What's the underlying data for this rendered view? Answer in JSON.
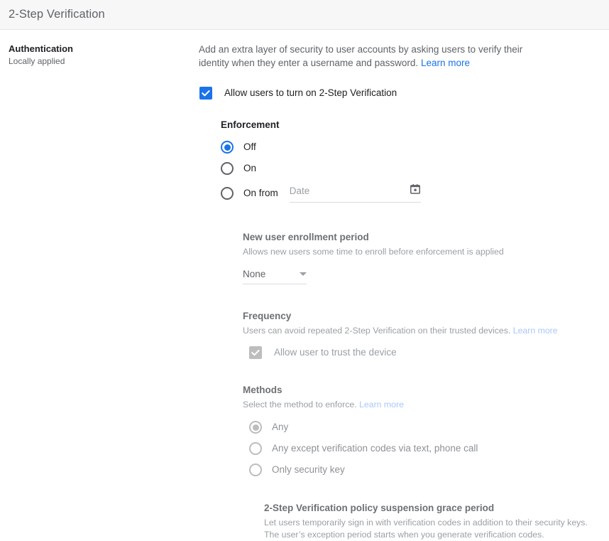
{
  "header": {
    "title": "2-Step Verification"
  },
  "left": {
    "section_name": "Authentication",
    "section_sub": "Locally applied"
  },
  "intro": {
    "text": "Add an extra layer of security to user accounts by asking users to verify their identity when they enter a username and password. ",
    "learn_more": "Learn more"
  },
  "allow": {
    "label": "Allow users to turn on 2-Step Verification",
    "checked": true
  },
  "enforcement": {
    "title": "Enforcement",
    "options": [
      {
        "label": "Off",
        "checked": true
      },
      {
        "label": "On",
        "checked": false
      },
      {
        "label": "On from",
        "checked": false
      }
    ],
    "date": {
      "placeholder": "Date",
      "value": "",
      "icon": "calendar-icon"
    }
  },
  "enrollment": {
    "title": "New user enrollment period",
    "desc": "Allows new users some time to enroll before enforcement is applied",
    "selected": "None"
  },
  "frequency": {
    "title": "Frequency",
    "desc": "Users can avoid repeated 2-Step Verification on their trusted devices. ",
    "learn_more": "Learn more",
    "checkbox_label": "Allow user to trust the device",
    "checked": true,
    "disabled": true
  },
  "methods": {
    "title": "Methods",
    "desc": "Select the method to enforce. ",
    "learn_more": "Learn more",
    "options": [
      {
        "label": "Any",
        "checked": true
      },
      {
        "label": "Any except verification codes via text, phone call",
        "checked": false
      },
      {
        "label": "Only security key",
        "checked": false
      }
    ],
    "disabled": true
  },
  "grace": {
    "title": "2-Step Verification policy suspension grace period",
    "desc": "Let users temporarily sign in with verification codes in addition to their security keys. The user’s exception period starts when you generate verification codes."
  },
  "colors": {
    "accent": "#1a73e8",
    "accent_disabled": "#a8c7fa",
    "disabled_gray": "#bdbdbd",
    "text": "#202124",
    "muted": "#5f6368",
    "header_bg": "#f7f7f7"
  }
}
